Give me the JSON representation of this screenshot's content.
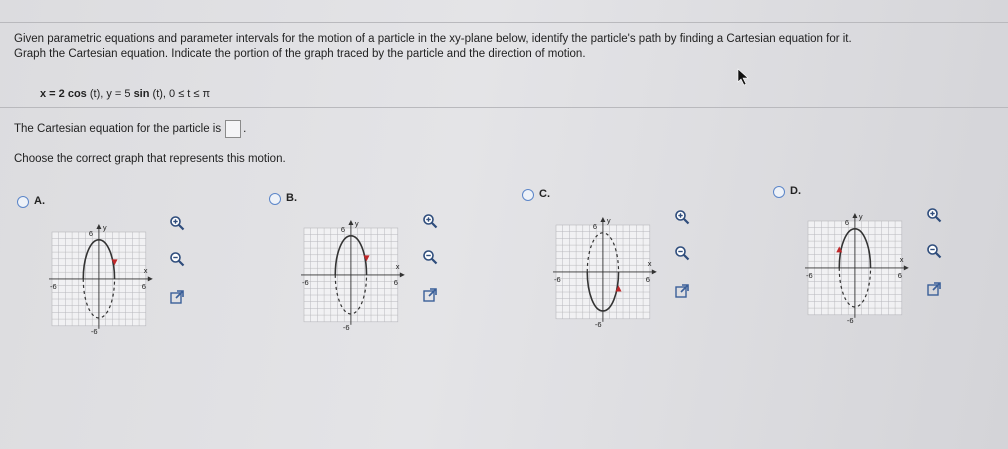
{
  "problem": {
    "line1": "Given parametric equations and parameter intervals for the motion of a particle in the xy-plane below, identify the particle's path by finding a Cartesian equation for it.",
    "line2": "Graph the Cartesian equation. Indicate the portion of the graph traced by the particle and the direction of motion.",
    "equation_x": "x = 2 cos",
    "equation_x_rest": " (t), y = 5 ",
    "equation_sin": "sin",
    "equation_rest": " (t), 0 ≤ t ≤ π",
    "answer_prefix": "The Cartesian equation for the particle is",
    "answer_suffix": ".",
    "choose_prompt": "Choose the correct graph that represents this motion."
  },
  "choices": [
    {
      "letter": "A.",
      "traced": "upper",
      "arrow": "start"
    },
    {
      "letter": "B.",
      "traced": "upper",
      "arrow": "start"
    },
    {
      "letter": "C.",
      "traced": "lower",
      "arrow": "start"
    },
    {
      "letter": "D.",
      "traced": "upper",
      "arrow": "end"
    }
  ],
  "graph_labels": {
    "y_axis": "y",
    "x_axis": "x",
    "y_top": "6",
    "y_bottom": "-6",
    "x_left": "-6",
    "x_right": "6"
  },
  "colors": {
    "accent": "#5c86c9",
    "arrow": "#c0282a",
    "curve": "#333333",
    "grid": "#b8b8bc"
  },
  "icons": [
    "zoom-in-icon",
    "zoom-out-icon",
    "popout-icon"
  ]
}
